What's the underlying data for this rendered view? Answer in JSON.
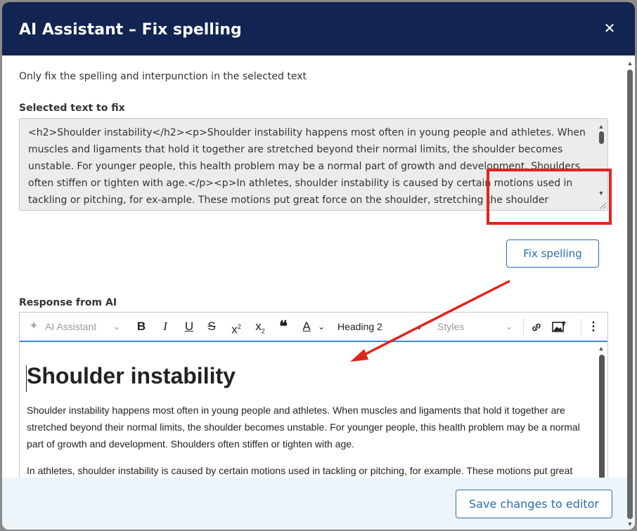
{
  "modal": {
    "title": "AI Assistant – Fix spelling",
    "close_icon": "close-icon",
    "description": "Only fix the spelling and interpunction in the selected text"
  },
  "source": {
    "label": "Selected text to fix",
    "text": "<h2>Shoulder instability</h2><p>Shoulder instability happens most often in young people and athletes. When muscles and ligaments that hold it together are stretched beyond their normal limits, the shoulder becomes unstable. For younger people, this health problem may be a normal part of growth and development. Shoulders often stiffen or tighten with age.</p><p>In athletes, shoulder instability is caused by certain motions used in tackling or pitching, for ex-ample. These motions put great force on the shoulder, stretching the shoulder ligaments over time. It can cause pain that"
  },
  "actions": {
    "fix_label": "Fix spelling",
    "save_label": "Save changes to editor"
  },
  "response": {
    "label": "Response from AI",
    "toolbar": {
      "ai_assistant_label": "AI Assistant",
      "heading_label": "Heading 2",
      "styles_label": "Styles",
      "icons": [
        "sparkle-icon",
        "bold-icon",
        "italic-icon",
        "underline-icon",
        "strikethrough-icon",
        "superscript-icon",
        "subscript-icon",
        "quote-icon",
        "font-color-icon",
        "link-icon",
        "image-icon",
        "more-vertical-icon"
      ]
    },
    "heading": "Shoulder instability",
    "paragraph1_line1": "Shoulder instability happens most often in young people and athletes. When muscles and ligaments that hold it together are",
    "paragraph1_line2": "stretched beyond their normal limits, the shoulder becomes unstable. For younger people, this health problem may be a normal",
    "paragraph1_line3": "part of growth and development. Shoulders often stiffen or tighten with age.",
    "paragraph2_line1": "In athletes, shoulder instability is caused by certain motions used in tackling or pitching, for example. These motions put great"
  },
  "annotation": {
    "highlight_color": "#e0251b"
  },
  "colors": {
    "header_bg": "#122451",
    "accent": "#2b6cb0",
    "footer_bg": "#eef5fa"
  }
}
